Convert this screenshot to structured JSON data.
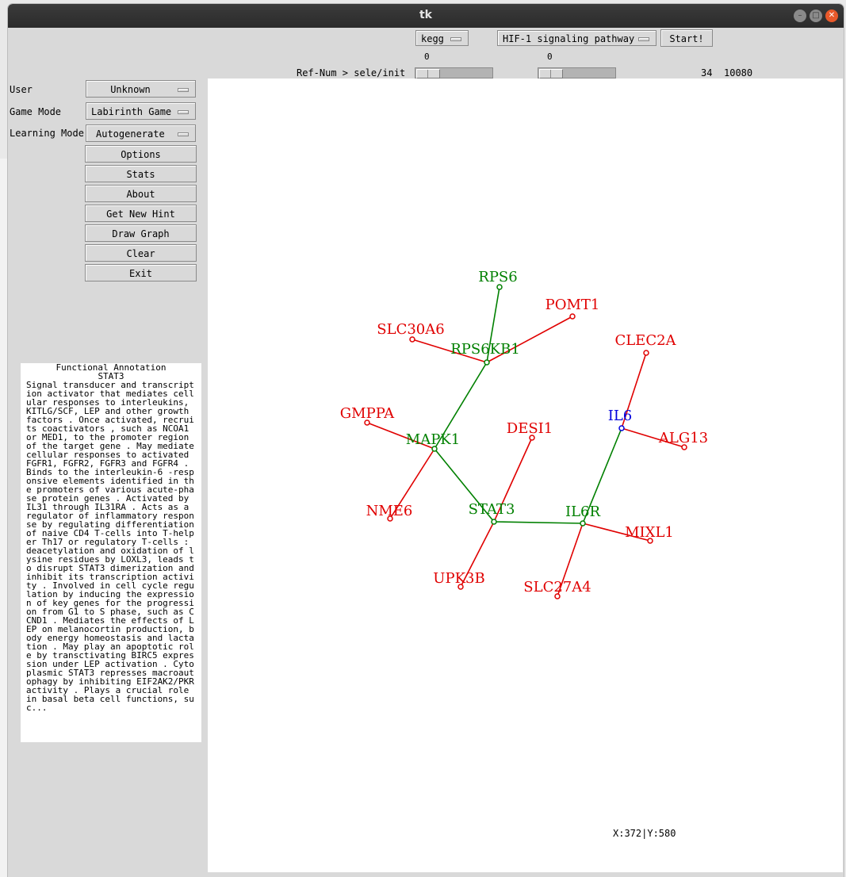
{
  "window": {
    "title": "tk"
  },
  "toolbar": {
    "database_select": "kegg",
    "pathway_select": "HIF-1 signaling pathway",
    "start_button": "Start!",
    "refnum_label": "Ref-Num > sele/init",
    "scale1_value": "0",
    "scale2_value": "0",
    "count_a": "34",
    "count_b": "10080"
  },
  "sidebar": {
    "user_label": "User",
    "user_value": "Unknown",
    "game_mode_label": "Game Mode",
    "game_mode_value": "Labirinth Game",
    "learning_mode_label": "Learning Mode",
    "learning_mode_value": "Autogenerate",
    "buttons": [
      "Options",
      "Stats",
      "About",
      "Get New Hint",
      "Draw Graph",
      "Clear",
      "Exit"
    ]
  },
  "annotation": {
    "title": "Functional Annotation",
    "gene": "STAT3",
    "text": "Signal transducer and transcription activator that mediates cellular responses to interleukins, KITLG/SCF, LEP and other growth factors . Once activated, recruits coactivators , such as NCOA1 or MED1, to the promoter region of the target gene . May mediate cellular responses to activated FGFR1, FGFR2, FGFR3 and FGFR4 . Binds to the interleukin-6 -responsive elements identified in the promoters of various acute-phase protein genes . Activated by IL31 through IL31RA . Acts as a regulator of inflammatory response by regulating differentiation of naive CD4 T-cells into T-helper Th17 or regulatory T-cells : deacetylation and oxidation of lysine residues by LOXL3, leads to disrupt STAT3 dimerization and inhibit its transcription activity . Involved in cell cycle regulation by inducing the expression of key genes for the progression from G1 to S phase, such as CCND1 . Mediates the effects of LEP on melanocortin production, body energy homeostasis and lactation . May play an apoptotic role by transctivating BIRC5 expression under LEP activation . Cytoplasmic STAT3 represses macroautophagy by inhibiting EIF2AK2/PKR activity . Plays a crucial role in basal beta cell functions, suc..."
  },
  "graph": {
    "colors": {
      "core": "#008000",
      "leaf": "#e00000",
      "target": "#0000dd"
    },
    "nodes": [
      {
        "id": "RPS6",
        "kind": "core"
      },
      {
        "id": "POMT1",
        "kind": "leaf"
      },
      {
        "id": "SLC30A6",
        "kind": "leaf"
      },
      {
        "id": "RPS6KB1",
        "kind": "core"
      },
      {
        "id": "CLEC2A",
        "kind": "leaf"
      },
      {
        "id": "GMPPA",
        "kind": "leaf"
      },
      {
        "id": "DESI1",
        "kind": "leaf"
      },
      {
        "id": "IL6",
        "kind": "target"
      },
      {
        "id": "MAPK1",
        "kind": "core"
      },
      {
        "id": "ALG13",
        "kind": "leaf"
      },
      {
        "id": "NME6",
        "kind": "leaf"
      },
      {
        "id": "STAT3",
        "kind": "core"
      },
      {
        "id": "IL6R",
        "kind": "core"
      },
      {
        "id": "MIXL1",
        "kind": "leaf"
      },
      {
        "id": "UPK3B",
        "kind": "leaf"
      },
      {
        "id": "SLC27A4",
        "kind": "leaf"
      }
    ],
    "edges": [
      [
        "RPS6KB1",
        "RPS6"
      ],
      [
        "RPS6KB1",
        "POMT1"
      ],
      [
        "RPS6KB1",
        "SLC30A6"
      ],
      [
        "RPS6KB1",
        "MAPK1"
      ],
      [
        "MAPK1",
        "GMPPA"
      ],
      [
        "MAPK1",
        "NME6"
      ],
      [
        "MAPK1",
        "STAT3"
      ],
      [
        "STAT3",
        "DESI1"
      ],
      [
        "STAT3",
        "UPK3B"
      ],
      [
        "STAT3",
        "IL6R"
      ],
      [
        "IL6R",
        "IL6"
      ],
      [
        "IL6",
        "CLEC2A"
      ],
      [
        "IL6",
        "ALG13"
      ],
      [
        "IL6R",
        "MIXL1"
      ],
      [
        "IL6R",
        "SLC27A4"
      ]
    ]
  },
  "status": {
    "coords": "X:372|Y:580"
  }
}
